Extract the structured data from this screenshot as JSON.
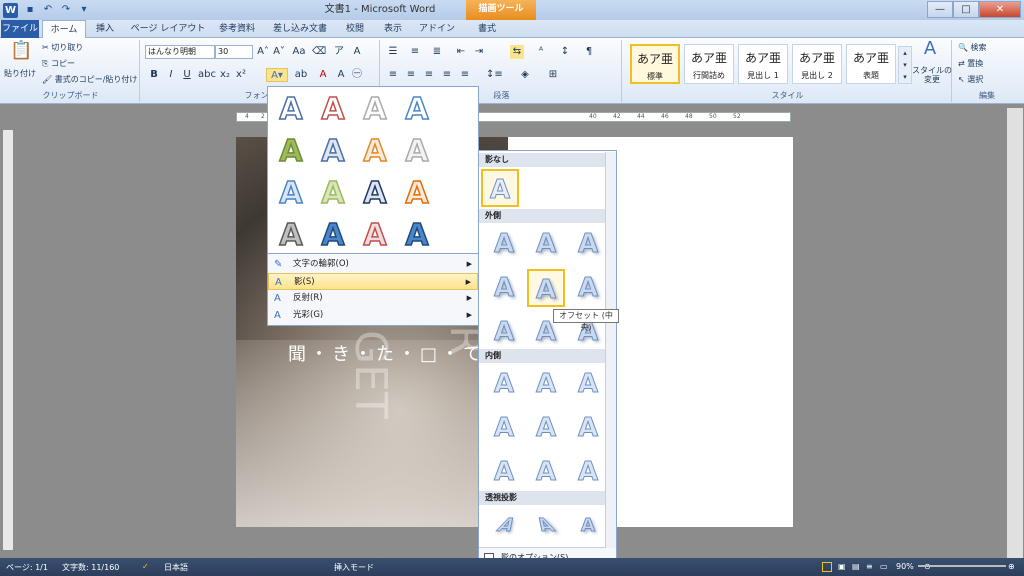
{
  "app": {
    "title": "文書1 - Microsoft Word",
    "context_tools": "描画ツール",
    "win_min": "—",
    "win_max": "□",
    "win_close": "✕"
  },
  "tabs": [
    {
      "label": "ファイル"
    },
    {
      "label": "ホーム"
    },
    {
      "label": "挿入"
    },
    {
      "label": "ページ レイアウト"
    },
    {
      "label": "参考資料"
    },
    {
      "label": "差し込み文書"
    },
    {
      "label": "校閲"
    },
    {
      "label": "表示"
    },
    {
      "label": "アドイン"
    },
    {
      "label": "書式"
    }
  ],
  "ribbon": {
    "clipboard": {
      "paste": "貼り付け",
      "cut": "切り取り",
      "copy": "コピー",
      "format_painter": "書式のコピー/貼り付け",
      "label": "クリップボード"
    },
    "font": {
      "name": "はんなり明朝",
      "size": "30",
      "label": "フォント"
    },
    "paragraph": {
      "label": "段落"
    },
    "styles": {
      "label": "スタイル",
      "change": "スタイルの変更",
      "items": [
        {
          "sample": "あア亜",
          "name": "標準"
        },
        {
          "sample": "あア亜",
          "name": "行間詰め"
        },
        {
          "sample": "あア亜",
          "name": "見出し 1"
        },
        {
          "sample": "あア亜",
          "name": "見出し 2"
        },
        {
          "sample": "あア亜",
          "name": "表題"
        }
      ]
    },
    "editing": {
      "find": "検索",
      "replace": "置換",
      "select": "選択",
      "label": "編集"
    }
  },
  "ruler": {
    "marks": [
      "4",
      "2",
      "40",
      "42",
      "44",
      "46",
      "48",
      "50",
      "52"
    ]
  },
  "document": {
    "vertical_text": "GET",
    "vertical_text2": "FR",
    "line": "聞・き・た・□・て"
  },
  "text_effects_menu": {
    "items": [
      {
        "label": "文字の輪郭(O)"
      },
      {
        "label": "影(S)"
      },
      {
        "label": "反射(R)"
      },
      {
        "label": "光彩(G)"
      }
    ]
  },
  "shadow_submenu": {
    "none": "影なし",
    "outer": "外側",
    "inner": "内側",
    "perspective": "透視投影",
    "options": "影のオプション(S)...",
    "tooltip": "オフセット (中央)"
  },
  "status": {
    "page": "ページ: 1/1",
    "words": "文字数: 11/160",
    "lang": "日本語",
    "mode": "挿入モード",
    "zoom": "90%"
  },
  "colors": {
    "accent": "#2a5ca8",
    "highlight": "#f0c020"
  }
}
